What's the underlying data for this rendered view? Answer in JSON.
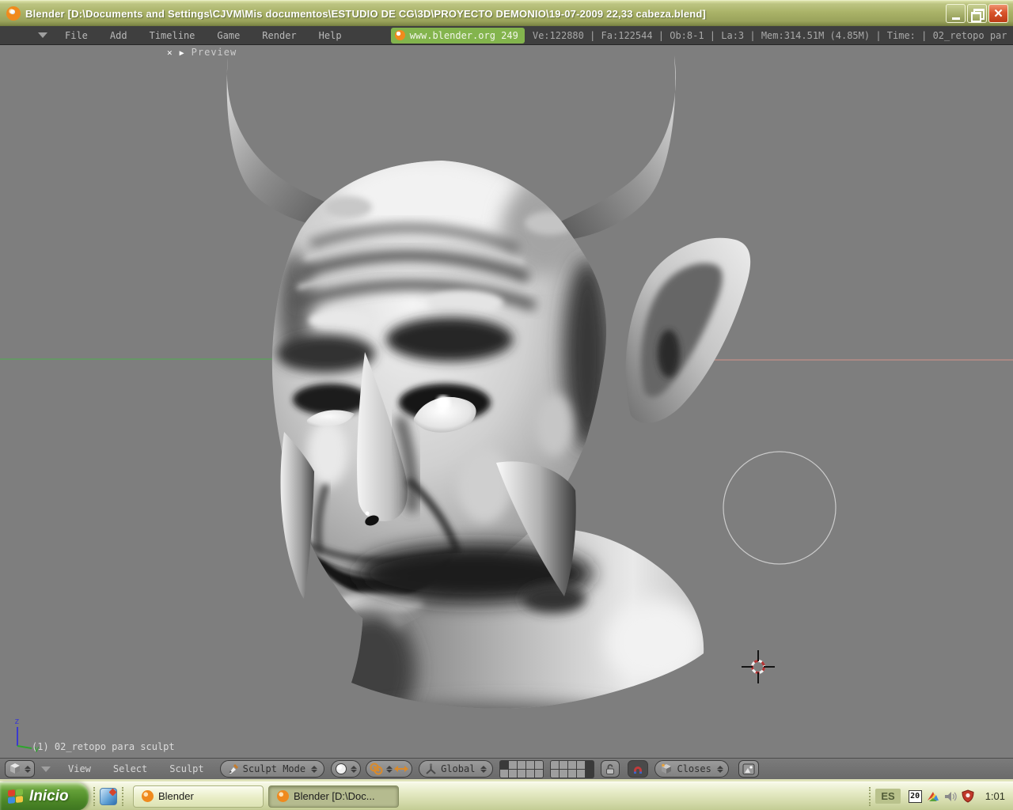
{
  "window": {
    "title": "Blender [D:\\Documents and Settings\\CJVM\\Mis documentos\\ESTUDIO DE CG\\3D\\PROYECTO DEMONIO\\19-07-2009  22,33 cabeza.blend]"
  },
  "menubar": {
    "menus": [
      "File",
      "Add",
      "Timeline",
      "Game",
      "Render",
      "Help"
    ],
    "badge_label": "www.blender.org 249",
    "stats": "Ve:122880 | Fa:122544 | Ob:8-1 | La:3  | Mem:314.51M (4.85M)  | Time: | 02_retopo par"
  },
  "viewport": {
    "preview_label": "Preview",
    "object_info": "(1) 02_retopo para sculpt",
    "axis_z_label": "z",
    "axis_y_label": "y"
  },
  "header3d": {
    "menus": [
      "View",
      "Select",
      "Sculpt"
    ],
    "mode_label": "Sculpt Mode",
    "orientation_label": "Global",
    "snap_label": "Closes"
  },
  "taskbar": {
    "start_label": "Inicio",
    "tasks": [
      {
        "label": "Blender"
      },
      {
        "label": "Blender [D:\\Doc..."
      }
    ],
    "tray": {
      "language": "ES",
      "calendar_day": "20",
      "clock": "1:01"
    }
  },
  "colors": {
    "badge_green": "#83b44d",
    "titlebar_olive": "#aab368",
    "close_button": "#d9542c",
    "viewport_bg": "#7e7e7e",
    "header_bg": "#6f6f6f",
    "taskbar_green": "#4d8827",
    "axis_y_green": "#59a659",
    "axis_x_red": "#c59089"
  }
}
